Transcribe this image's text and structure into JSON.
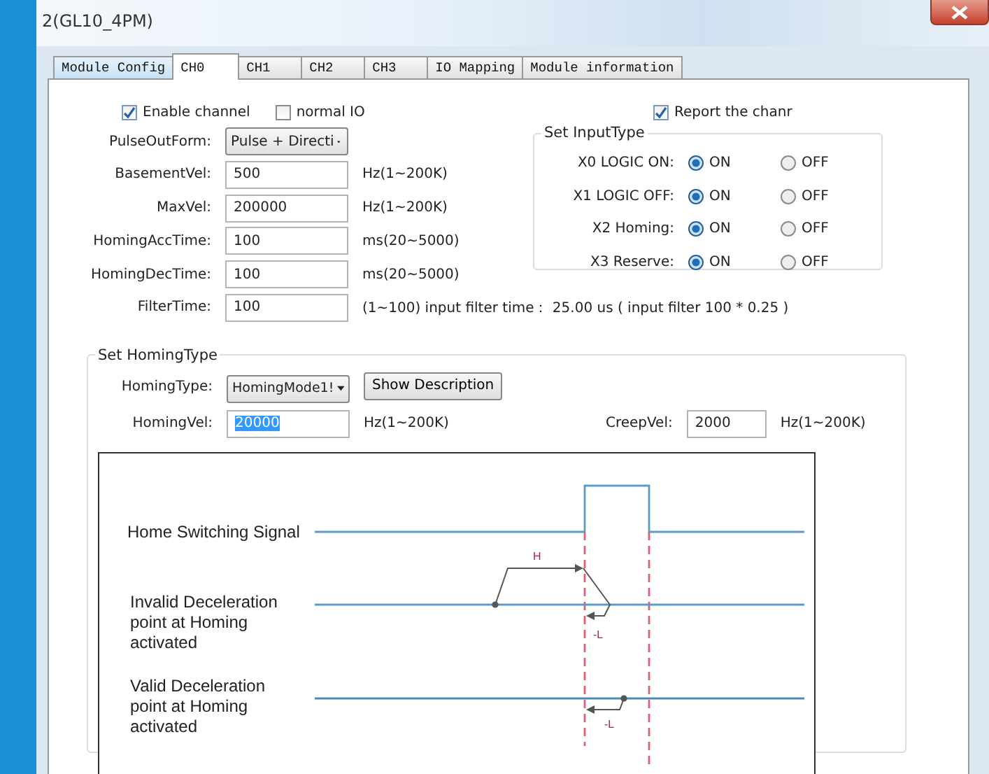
{
  "window": {
    "title": "2(GL10_4PM)"
  },
  "tabs": [
    {
      "label": "Module Config",
      "selected": false
    },
    {
      "label": "CH0",
      "selected": true
    },
    {
      "label": "CH1",
      "selected": false
    },
    {
      "label": "CH2",
      "selected": false
    },
    {
      "label": "CH3",
      "selected": false
    },
    {
      "label": "IO Mapping",
      "selected": false
    },
    {
      "label": "Module information",
      "selected": false
    }
  ],
  "checkboxes": [
    {
      "label": "Enable channel",
      "checked": true
    },
    {
      "label": "normal IO",
      "checked": false
    }
  ],
  "report_checkbox": {
    "label": "Report the chanr",
    "checked": true
  },
  "parameters": [
    {
      "kind": "dropdown",
      "label": "PulseOutForm:",
      "value": "Pulse + Directi"
    },
    {
      "kind": "text",
      "label": "BasementVel:",
      "value": "500",
      "unit": "Hz(1~200K)"
    },
    {
      "kind": "text",
      "label": "MaxVel:",
      "value": "200000",
      "unit": "Hz(1~200K)"
    },
    {
      "kind": "text",
      "label": "HomingAccTime:",
      "value": "100",
      "unit": "ms(20~5000)"
    },
    {
      "kind": "text",
      "label": "HomingDecTime:",
      "value": "100",
      "unit": "ms(20~5000)"
    },
    {
      "kind": "text",
      "label": "FilterTime:",
      "value": "100",
      "unit": "(1~100)  input filter time： 25.00 us ( input filter 100 * 0.25 )"
    }
  ],
  "input_type": {
    "title": "Set InputType",
    "rows": [
      {
        "label": "X0 LOGIC ON:",
        "options": [
          {
            "label": "ON",
            "selected": true
          },
          {
            "label": "OFF",
            "selected": false
          }
        ]
      },
      {
        "label": "X1 LOGIC OFF:",
        "options": [
          {
            "label": "ON",
            "selected": true
          },
          {
            "label": "OFF",
            "selected": false
          }
        ]
      },
      {
        "label": "X2 Homing:",
        "options": [
          {
            "label": "ON",
            "selected": true
          },
          {
            "label": "OFF",
            "selected": false
          }
        ]
      },
      {
        "label": "X3 Reserve:",
        "options": [
          {
            "label": "ON",
            "selected": true
          },
          {
            "label": "OFF",
            "selected": false
          }
        ]
      }
    ]
  },
  "homing": {
    "title": "Set HomingType",
    "homing_type": {
      "label": "HomingType:",
      "value": "HomingMode1!"
    },
    "show_description": "Show Description",
    "homing_vel": {
      "label": "HomingVel:",
      "value": "20000",
      "unit": "Hz(1~200K)",
      "selected": true
    },
    "creep_vel": {
      "label": "CreepVel:",
      "value": "2000",
      "unit": "Hz(1~200K)",
      "selected": false
    },
    "diagram": {
      "signals": [
        {
          "kind": "switch",
          "label": "Home Switching Signal"
        },
        {
          "kind": "invalid",
          "label": "Invalid Deceleration point at Homing activated",
          "marks": [
            "H",
            "-L"
          ]
        },
        {
          "kind": "valid",
          "label": "Valid Deceleration point at Homing activated",
          "marks": [
            "-L"
          ]
        }
      ]
    }
  }
}
